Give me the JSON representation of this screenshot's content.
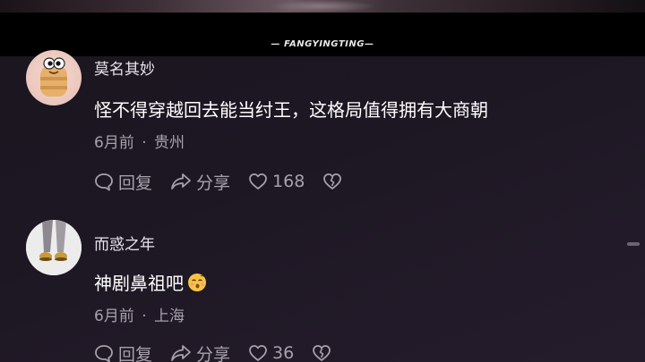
{
  "video": {
    "watermark": "— FANGYINGTING—"
  },
  "comments": [
    {
      "username": "莫名其妙",
      "text": "怪不得穿越回去能当纣王，这格局值得拥有大商朝",
      "time": "6月前",
      "separator": "·",
      "location": "贵州",
      "reply_label": "回复",
      "share_label": "分享",
      "like_count": "168",
      "avatar_icon": "cartoon-character-avatar"
    },
    {
      "username": "而惑之年",
      "text": "神剧鼻祖吧",
      "emoji": "kissing-face-emoji",
      "time": "6月前",
      "separator": "·",
      "location": "上海",
      "reply_label": "回复",
      "share_label": "分享",
      "like_count": "36",
      "avatar_icon": "legs-photo-avatar"
    }
  ],
  "colors": {
    "panel_bg": "#1d1723",
    "text_primary": "#ffffff",
    "text_secondary": "#a6a1ab"
  }
}
